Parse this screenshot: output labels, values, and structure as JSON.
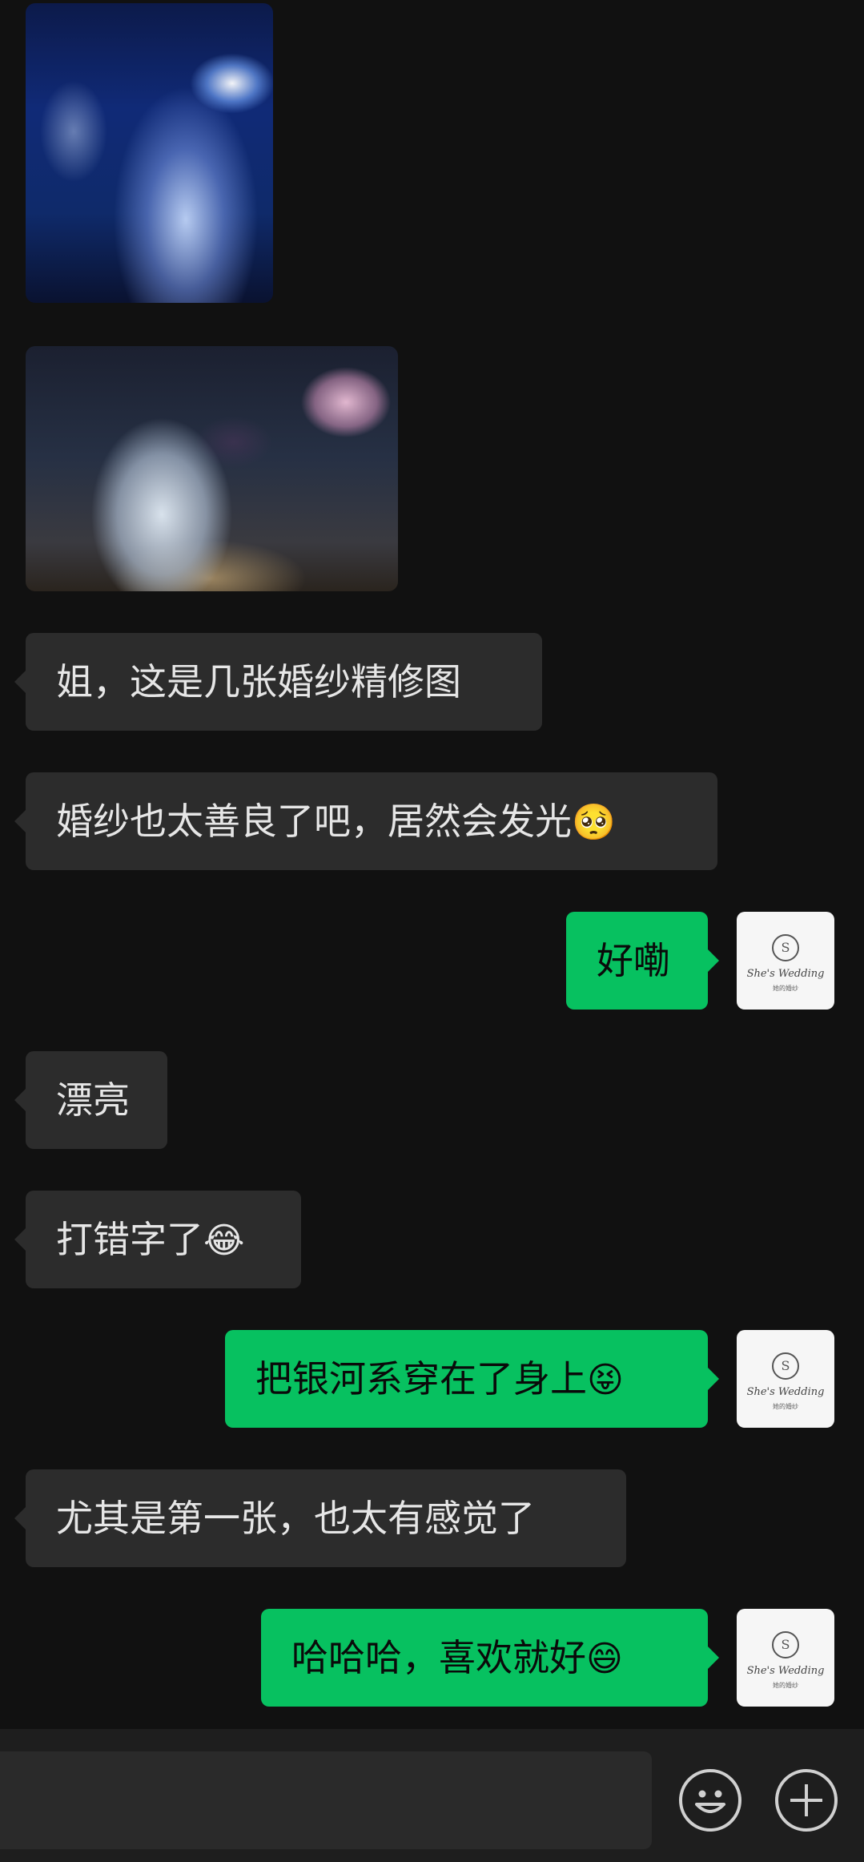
{
  "messages": [
    {
      "type": "image",
      "from": "other",
      "alt": "bride-under-blue-light"
    },
    {
      "type": "image",
      "from": "other",
      "alt": "groom-kneeling-with-bouquet"
    },
    {
      "type": "text",
      "from": "other",
      "text": "姐，这是几张婚纱精修图"
    },
    {
      "type": "text",
      "from": "other",
      "text": "婚纱也太善良了吧，居然会发光",
      "emoji": "🥺"
    },
    {
      "type": "text",
      "from": "me",
      "text": "好嘞"
    },
    {
      "type": "text",
      "from": "other",
      "text": "漂亮"
    },
    {
      "type": "text",
      "from": "other",
      "text": "打错字了",
      "emoji": "😂"
    },
    {
      "type": "text",
      "from": "me",
      "text": "把银河系穿在了身上",
      "emoji": "😝"
    },
    {
      "type": "text",
      "from": "other",
      "text": "尤其是第一张，也太有感觉了"
    },
    {
      "type": "text",
      "from": "me",
      "text": "哈哈哈，喜欢就好",
      "emoji": "😄"
    }
  ],
  "avatar": {
    "brand": "She's Wedding",
    "sub": "她的婚纱",
    "mark": "S"
  },
  "input": {
    "value": "",
    "emoji_button": "emoji-face-icon",
    "more_button": "plus-circle-icon"
  },
  "colors": {
    "background": "#111111",
    "incoming_bubble": "#2c2c2c",
    "outgoing_bubble": "#07c160",
    "input_bar": "#1e1e1e"
  }
}
